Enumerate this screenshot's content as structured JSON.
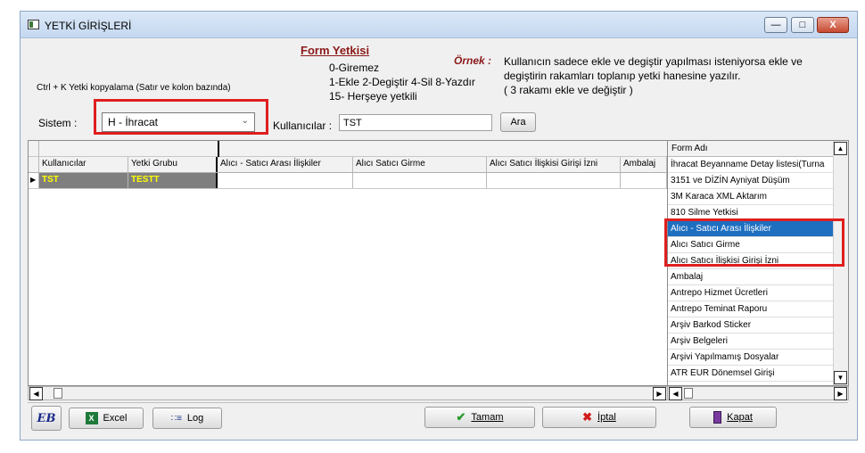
{
  "window": {
    "title": "YETKİ GİRİŞLERİ",
    "min_glyph": "—",
    "max_glyph": "□",
    "close_glyph": "X"
  },
  "form": {
    "title": "Form Yetkisi",
    "codes": [
      "0-Giremez",
      "1-Ekle  2-Degiştir  4-Sil  8-Yazdır",
      "15- Herşeye yetkili"
    ],
    "ornek_label": "Örnek :",
    "example_lines": [
      "Kullanıcın sadece ekle ve degiştir yapılması isteniyorsa  ekle ve",
      "degiştirin rakamları toplanıp yetki hanesine yazılır.",
      " ( 3 rakamı ekle ve değiştir )"
    ],
    "copy_hint": "Ctrl + K Yetki kopyalama (Satır ve kolon bazında)"
  },
  "filters": {
    "sistem_label": "Sistem :",
    "sistem_value": "H - İhracat",
    "kullanicilar_label": "Kullanıcılar :",
    "kullanicilar_value": "TST",
    "ara_label": "Ara"
  },
  "grid": {
    "columns": [
      "Kullanıcılar",
      "Yetki Grubu",
      "Alıcı - Satıcı Arası İlişkiler",
      "Alıcı Satıcı Girme",
      "Alıcı Satıcı İlişkisi Girişi İzni",
      "Ambalaj"
    ],
    "rows": [
      {
        "user": "TST",
        "group": "TESTT",
        "cells": [
          "",
          "",
          "",
          ""
        ]
      }
    ]
  },
  "form_list": {
    "header": "Form Adı",
    "items": [
      "İhracat Beyanname Detay listesi(Turna",
      "3151 ve DİZİN Ayniyat Düşüm",
      "3M Karaca XML Aktarım",
      "810 Silme Yetkisi",
      "Alıcı - Satıcı Arası İlişkiler",
      "Alıcı Satıcı Girme",
      "Alıcı Satıcı İlişkisi Girişi İzni",
      "Ambalaj",
      "Antrepo Hizmet Ücretleri",
      "Antrepo Teminat Raporu",
      "Arşiv Barkod Sticker",
      "Arşiv Belgeleri",
      "Arşivi Yapılmamış Dosyalar",
      "ATR EUR Dönemsel Girişi"
    ],
    "active_index": 4
  },
  "toolbar": {
    "logo_text": "EB",
    "excel_label": "Excel",
    "log_label": "Log",
    "tamam_label": "Tamam",
    "iptal_label": "İptal",
    "kapat_label": "Kapat"
  },
  "colors": {
    "highlight_red": "#e01e1e",
    "selected_row_bg": "#7f7f7f",
    "selected_row_text": "#ffff00",
    "list_active_bg": "#1f6fc1"
  }
}
